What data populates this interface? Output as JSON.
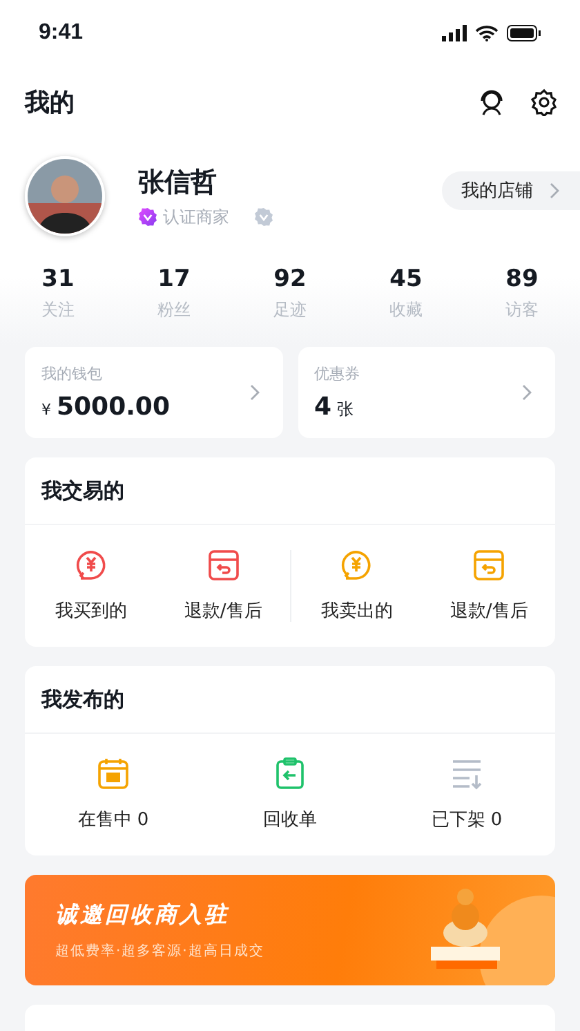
{
  "status_bar": {
    "time": "9:41"
  },
  "header": {
    "title": "我的"
  },
  "profile": {
    "name": "张信哲",
    "badge": "认证商家",
    "store_button": "我的店铺"
  },
  "stats": [
    {
      "value": "31",
      "label": "关注"
    },
    {
      "value": "17",
      "label": "粉丝"
    },
    {
      "value": "92",
      "label": "足迹"
    },
    {
      "value": "45",
      "label": "收藏"
    },
    {
      "value": "89",
      "label": "访客"
    }
  ],
  "wallet": {
    "label": "我的钱包",
    "currency": "¥",
    "amount": "5000.00"
  },
  "coupons": {
    "label": "优惠券",
    "count": "4",
    "unit": "张"
  },
  "trade": {
    "title": "我交易的",
    "groups": [
      [
        {
          "kind": "coin",
          "color": "#f04b4b",
          "label": "我买到的"
        },
        {
          "kind": "box",
          "color": "#f04b4b",
          "label": "退款/售后"
        }
      ],
      [
        {
          "kind": "coin",
          "color": "#f5a300",
          "label": "我卖出的"
        },
        {
          "kind": "box",
          "color": "#f5a300",
          "label": "退款/售后"
        }
      ]
    ]
  },
  "publish": {
    "title": "我发布的",
    "items": [
      {
        "kind": "calendar",
        "color": "#f5a300",
        "label": "在售中 0"
      },
      {
        "kind": "clipboard",
        "color": "#1fc26b",
        "label": "回收单"
      },
      {
        "kind": "list",
        "color": "#b4bcc8",
        "label": "已下架 0"
      }
    ]
  },
  "banner": {
    "title": "诚邀回收商入驻",
    "subtitle": "超低费率·超多客源·超高日成交"
  }
}
